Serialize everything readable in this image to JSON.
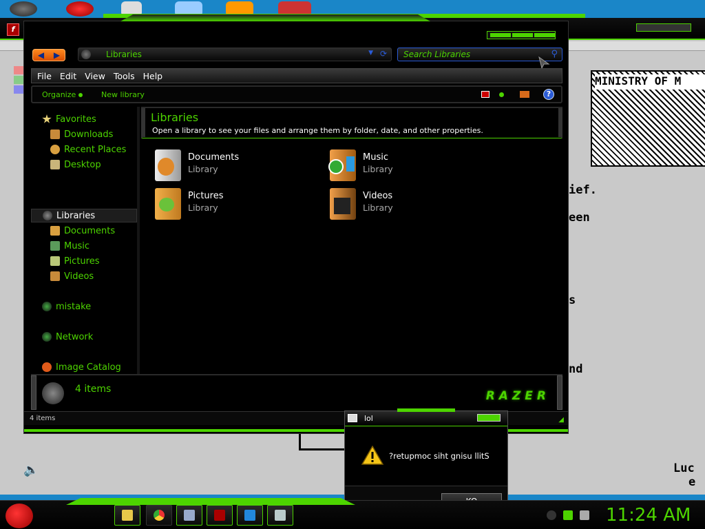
{
  "explorer": {
    "address": "Libraries",
    "search_placeholder": "Search Libraries",
    "menu": [
      "File",
      "Edit",
      "View",
      "Tools",
      "Help"
    ],
    "commands": {
      "organize": "Organize",
      "new_library": "New library"
    },
    "nav": {
      "favorites": "Favorites",
      "favorites_items": [
        "Downloads",
        "Recent Places",
        "Desktop"
      ],
      "libraries": "Libraries",
      "libraries_items": [
        "Documents",
        "Music",
        "Pictures",
        "Videos"
      ],
      "mistake": "mistake",
      "network": "Network",
      "image_catalog": "Image Catalog"
    },
    "header": {
      "title": "Libraries",
      "description": "Open a library to see your files and arrange them by folder, date, and other properties."
    },
    "libraries": [
      {
        "name": "Documents",
        "type": "Library",
        "icon": "documents-library-icon"
      },
      {
        "name": "Music",
        "type": "Library",
        "icon": "music-library-icon"
      },
      {
        "name": "Pictures",
        "type": "Library",
        "icon": "pictures-library-icon"
      },
      {
        "name": "Videos",
        "type": "Library",
        "icon": "videos-library-icon"
      }
    ],
    "details_count": "4 items",
    "status_text": "4 items",
    "brand": "RAZER"
  },
  "background_doc": {
    "logo_text": "MINISTRY OF M",
    "fragments": [
      "ief.",
      "een",
      "s",
      "nd",
      "Luc",
      "e"
    ]
  },
  "dialog": {
    "title": "lol",
    "message": "?retupmoc siht gnisu llitS",
    "ok_label": "KO"
  },
  "taskbar": {
    "clock": "11:24 AM",
    "pinned": [
      "explorer-icon",
      "chrome-icon",
      "notepad-icon",
      "flash-icon",
      "book-icon",
      "document-viewer-icon"
    ]
  },
  "colors": {
    "accent": "#4dd400",
    "desktop": "#1a86c8"
  }
}
